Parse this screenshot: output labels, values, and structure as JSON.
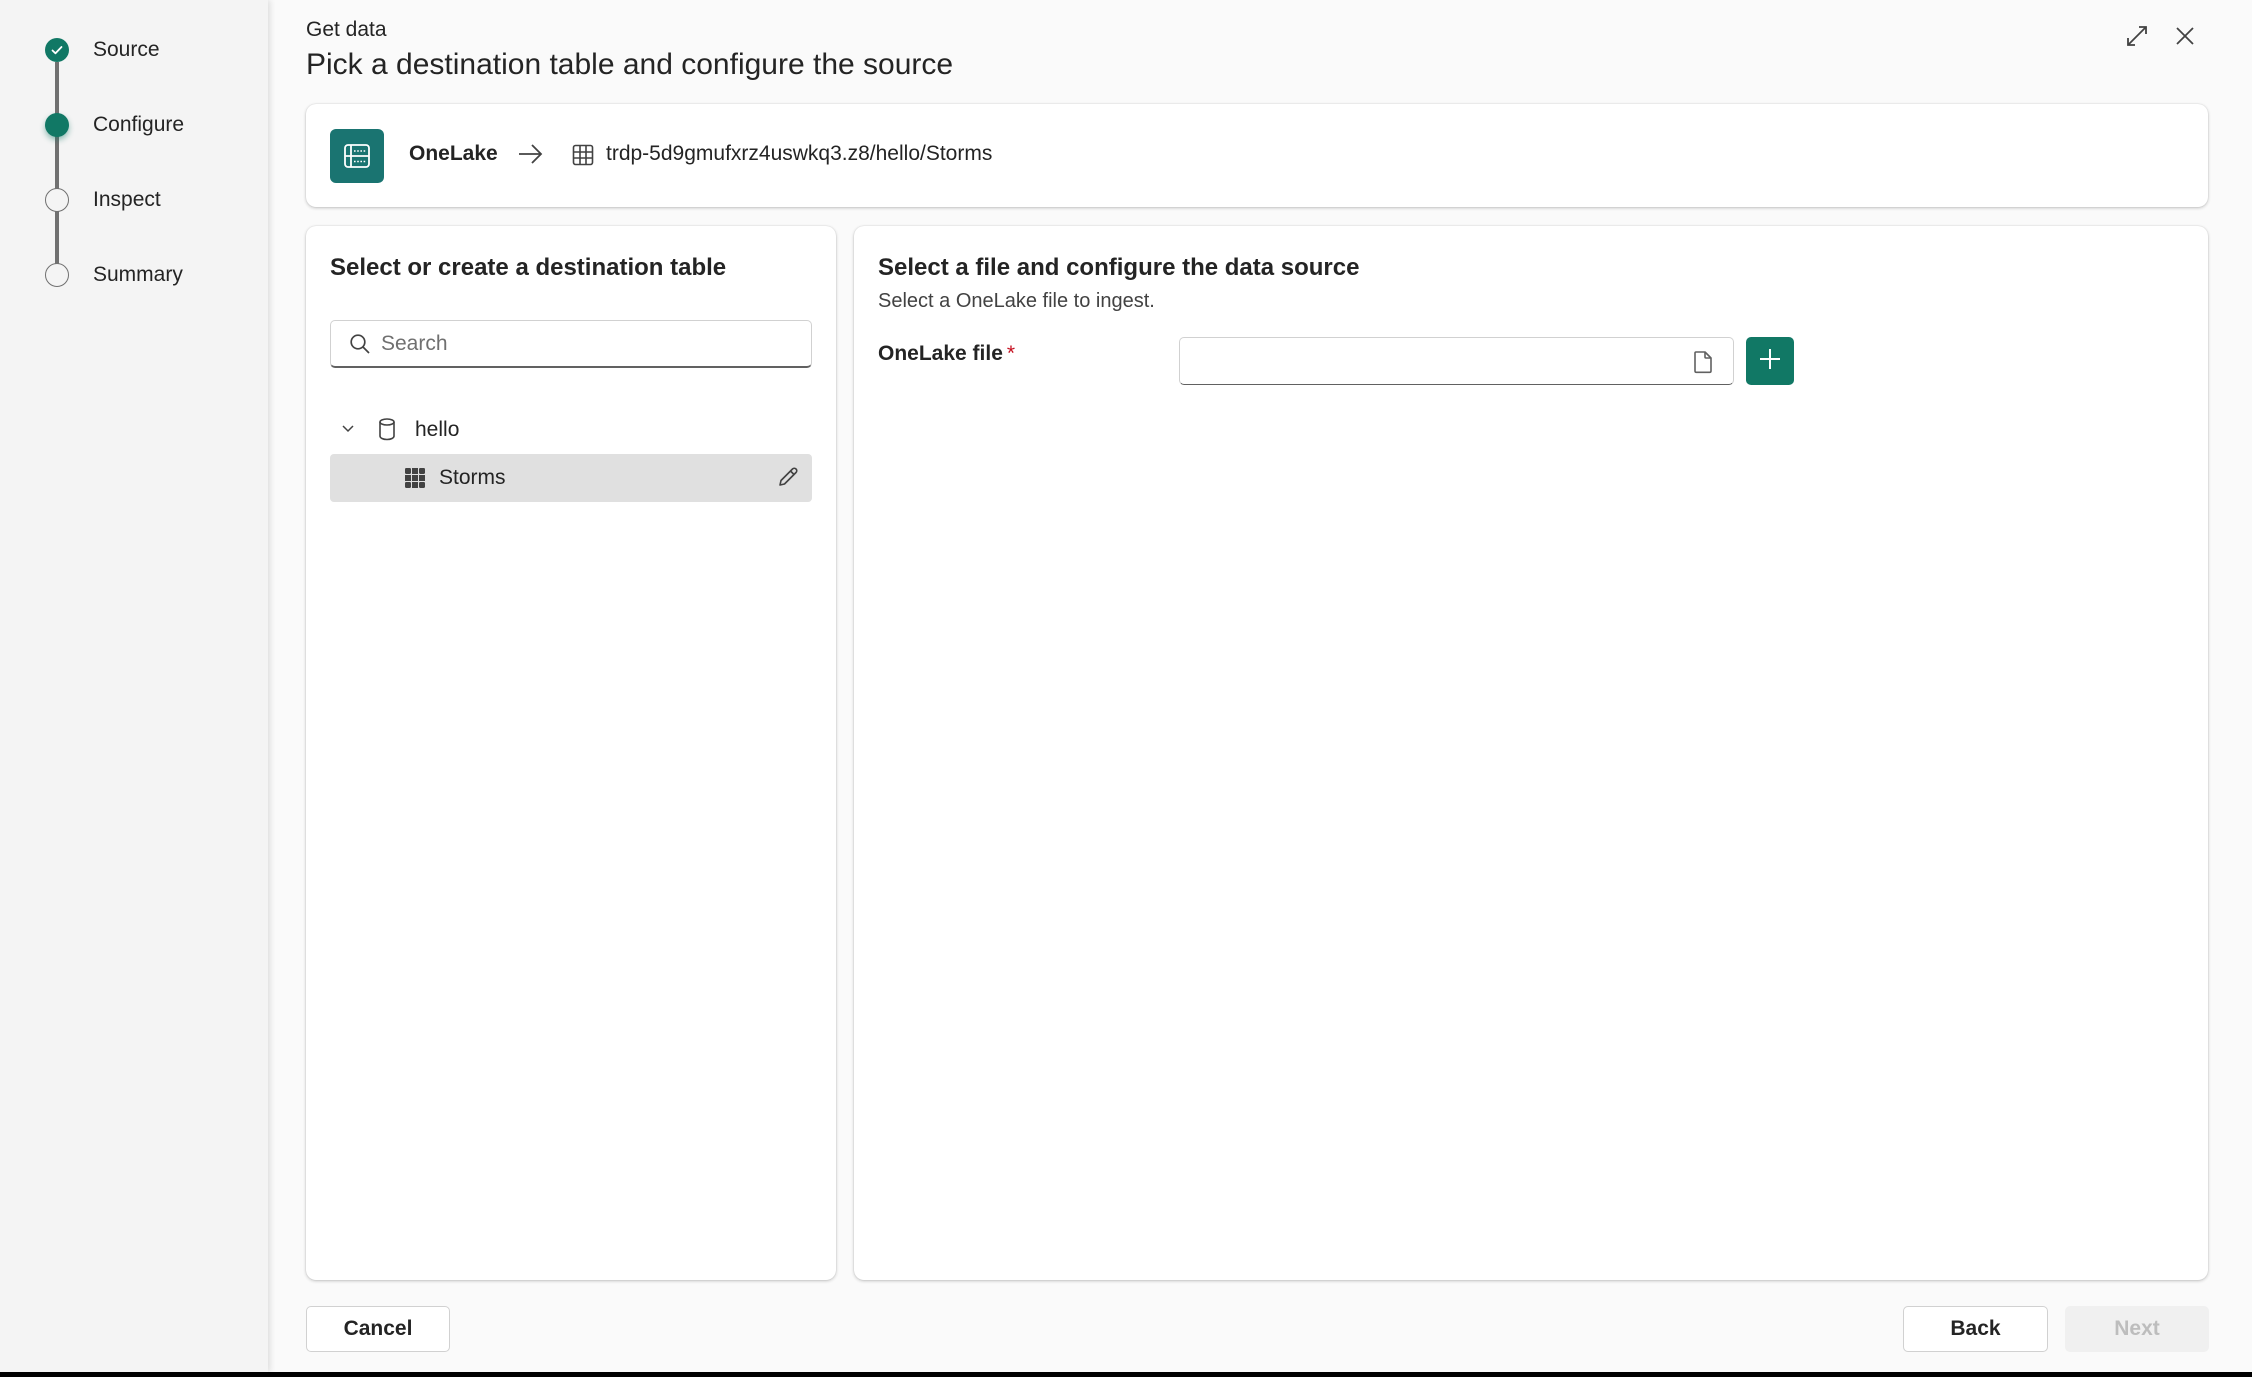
{
  "steps": [
    {
      "label": "Source",
      "state": "done"
    },
    {
      "label": "Configure",
      "state": "current"
    },
    {
      "label": "Inspect",
      "state": "todo"
    },
    {
      "label": "Summary",
      "state": "todo"
    }
  ],
  "header": {
    "eyebrow": "Get data",
    "title": "Pick a destination table and configure the source",
    "expand_icon": "expand-icon",
    "close_icon": "close-icon"
  },
  "source_card": {
    "source_name": "OneLake",
    "source_icon": "onelake-icon",
    "arrow_icon": "arrow-right-icon",
    "destination_path": "trdp-5d9gmufxrz4uswkq3.z8/hello/Storms",
    "destination_icon": "table-icon"
  },
  "destination_panel": {
    "title": "Select or create a destination table",
    "search": {
      "placeholder": "Search",
      "value": ""
    },
    "tree": {
      "database": {
        "name": "hello",
        "expanded": true
      },
      "tables": [
        {
          "name": "Storms",
          "selected": true
        }
      ]
    }
  },
  "source_panel": {
    "title": "Select a file and configure the data source",
    "subtitle": "Select a OneLake file to ingest.",
    "file_field": {
      "label": "OneLake file",
      "required_marker": "*",
      "value": "",
      "placeholder": ""
    }
  },
  "footer": {
    "cancel_label": "Cancel",
    "back_label": "Back",
    "next_label": "Next",
    "next_enabled": false
  },
  "colors": {
    "accent": "#117865",
    "source_icon_bg": "#1a7471",
    "required": "#c50f1f",
    "selected_row": "#e0e0e0"
  }
}
